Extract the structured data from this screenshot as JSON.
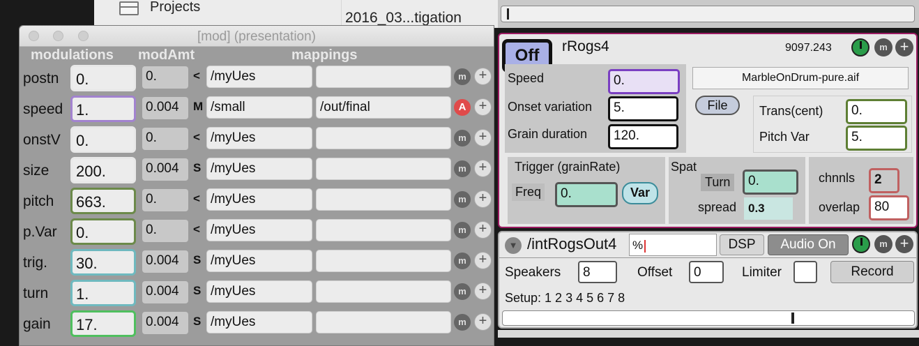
{
  "finder": {
    "projects_label": "Projects",
    "file_label": "2016_03...tigation"
  },
  "mod_window": {
    "title": "[mod] (presentation)",
    "headers": {
      "modulations": "modulations",
      "modAmt": "modAmt",
      "mappings": "mappings"
    },
    "rows": [
      {
        "label": "postn",
        "value": "0.",
        "amt": "0.",
        "mark": "<",
        "path": "/myUes",
        "out": "",
        "btn": "m",
        "color": "#e8e8e8"
      },
      {
        "label": "speed",
        "value": "1.",
        "amt": "0.004",
        "mark": "M",
        "path": "/small",
        "out": "/out/final",
        "btn": "A",
        "color": "#a283cf"
      },
      {
        "label": "onstV",
        "value": "0.",
        "amt": "0.",
        "mark": "<",
        "path": "/myUes",
        "out": "",
        "btn": "m",
        "color": "#e8e8e8"
      },
      {
        "label": "size",
        "value": "200.",
        "amt": "0.004",
        "mark": "S",
        "path": "/myUes",
        "out": "",
        "btn": "m",
        "color": "#e8e8e8"
      },
      {
        "label": "pitch",
        "value": "663.",
        "amt": "0.",
        "mark": "<",
        "path": "/myUes",
        "out": "",
        "btn": "m",
        "color": "#6c8a4a"
      },
      {
        "label": "p.Var",
        "value": "0.",
        "amt": "0.",
        "mark": "<",
        "path": "/myUes",
        "out": "",
        "btn": "m",
        "color": "#6c8a4a"
      },
      {
        "label": "trig.",
        "value": "30.",
        "amt": "0.004",
        "mark": "S",
        "path": "/myUes",
        "out": "",
        "btn": "m",
        "color": "#6fb9bf"
      },
      {
        "label": "turn",
        "value": "1.",
        "amt": "0.004",
        "mark": "S",
        "path": "/myUes",
        "out": "",
        "btn": "m",
        "color": "#6fb9bf"
      },
      {
        "label": "gain",
        "value": "17.",
        "amt": "0.004",
        "mark": "S",
        "path": "/myUes",
        "out": "",
        "btn": "m",
        "color": "#4fbf5e"
      }
    ],
    "plus": "+"
  },
  "grain": {
    "off_label": "Off",
    "name": "rRogs4",
    "number": "9097.243",
    "m_label": "m",
    "plus": "+",
    "speed_label": "Speed",
    "speed_value": "0.",
    "onset_label": "Onset variation",
    "onset_value": "5.",
    "duration_label": "Grain duration",
    "duration_value": "120.",
    "file_name": "MarbleOnDrum-pure.aif",
    "file_button": "File",
    "trans_label": "Trans(cent)",
    "trans_value": "0.",
    "pitchvar_label": "Pitch Var",
    "pitchvar_value": "5.",
    "trigger_label": "Trigger (grainRate)",
    "freq_label": "Freq",
    "freq_value": "0.",
    "var_button": "Var",
    "spat_label": "Spat",
    "turn_label": "Turn",
    "turn_value": "0.",
    "spread_label": "spread",
    "spread_value": "0.3",
    "chnnls_label": "chnnls",
    "chnnls_value": "2",
    "overlap_label": "overlap",
    "overlap_value": "80"
  },
  "output": {
    "name": "/intRogsOut4",
    "percent": "%",
    "dsp_button": "DSP",
    "audio_button": "Audio On",
    "m_label": "m",
    "plus": "+",
    "speakers_label": "Speakers",
    "speakers_value": "8",
    "offset_label": "Offset",
    "offset_value": "0",
    "limiter_label": "Limiter",
    "record_button": "Record",
    "setup_text": "Setup:  1 2 3 4 5 6 7 8"
  },
  "colors": {
    "accent_magenta": "#9c1b62",
    "knob_green": "#2a9d4a",
    "off_blue": "#a9b0e6"
  }
}
